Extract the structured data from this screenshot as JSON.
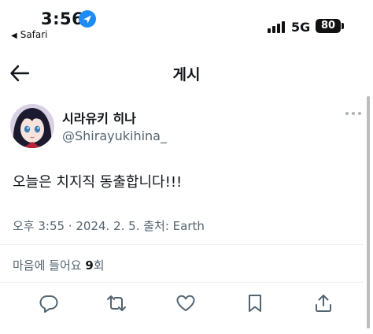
{
  "status_bar": {
    "time": "3:56",
    "back_app": "Safari",
    "network": "5G",
    "battery": "80"
  },
  "header": {
    "title": "게시"
  },
  "post": {
    "author_name": "시라유키 히나",
    "author_handle": "@Shirayukihina_",
    "text": "오늘은 치지직 동출합니다!!!",
    "meta": "오후 3:55 · 2024. 2. 5. 출처: Earth",
    "views_prefix": "마음에 들어요 ",
    "views_count": "9",
    "views_suffix": "회"
  },
  "actions": [
    "reply-icon",
    "retweet-icon",
    "like-icon",
    "bookmark-icon",
    "share-icon"
  ]
}
